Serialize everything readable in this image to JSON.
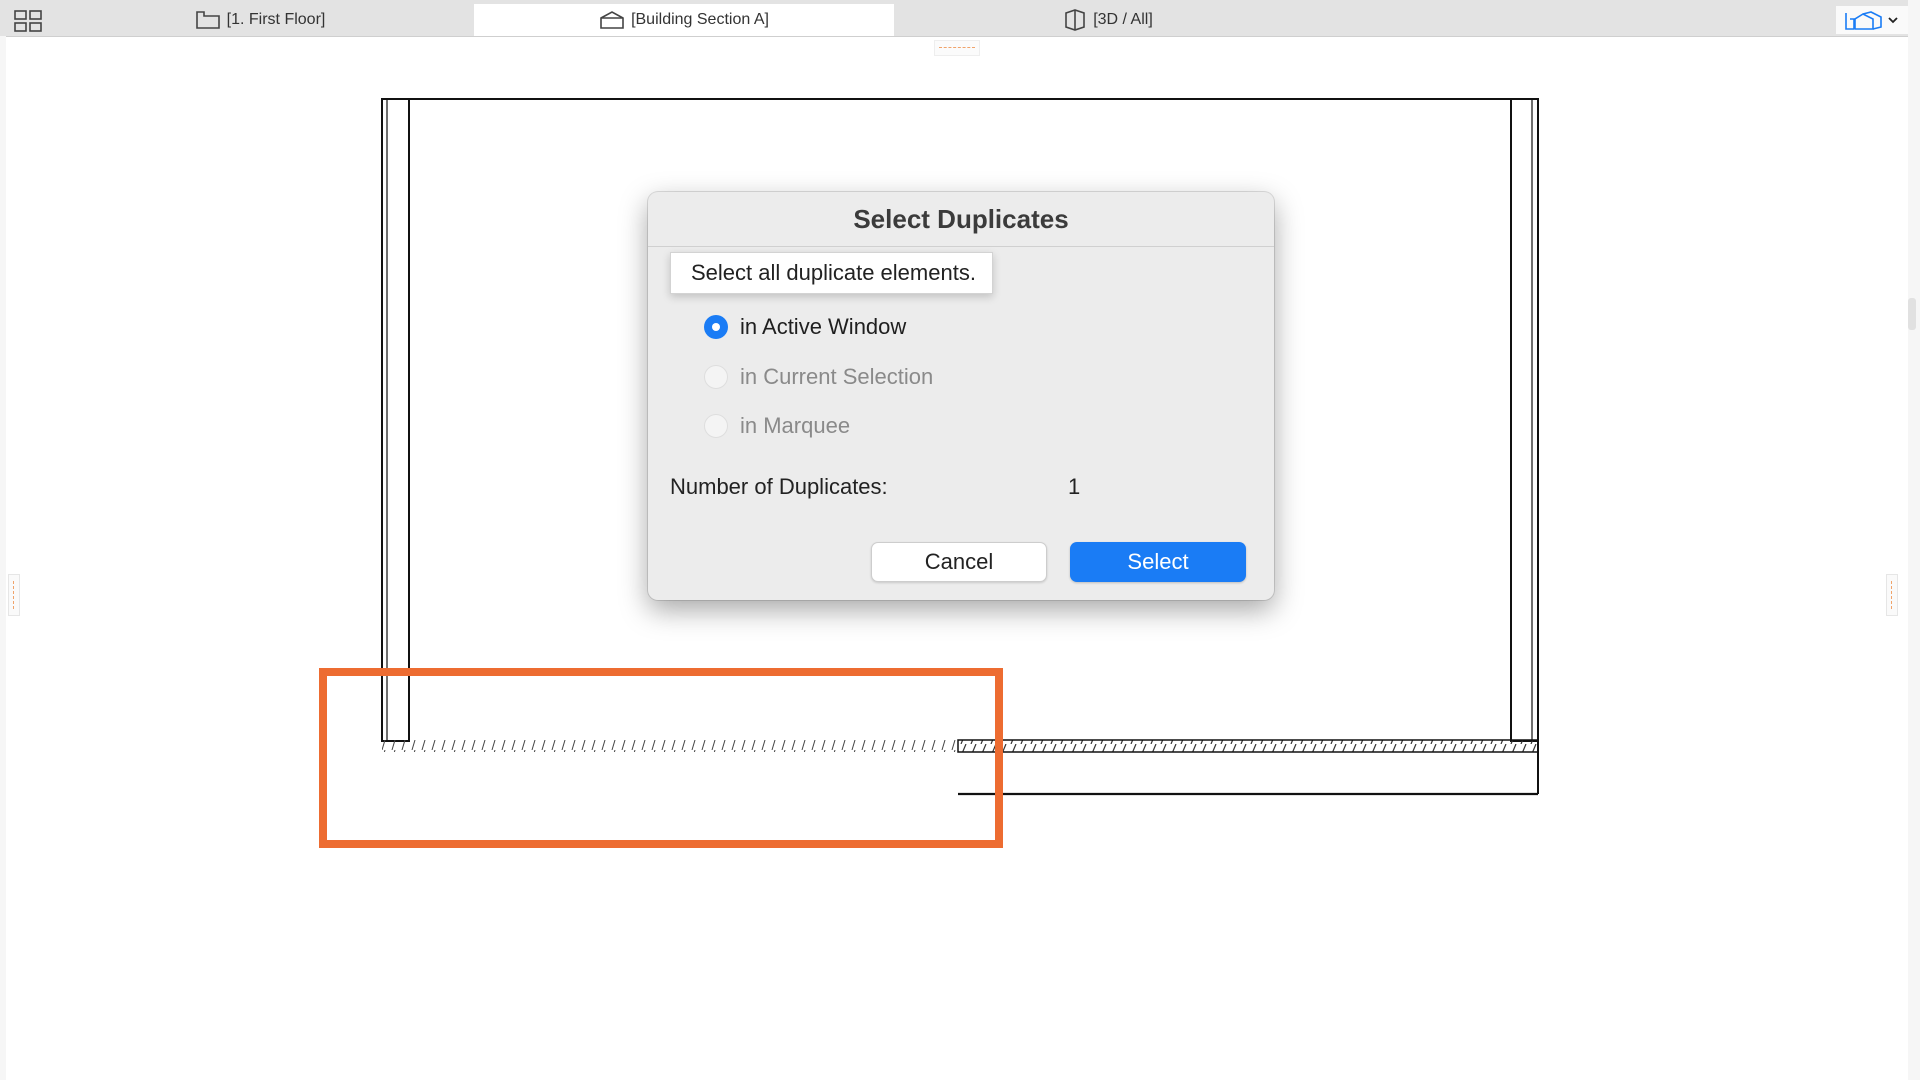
{
  "tabs": [
    {
      "label": "[1. First Floor]",
      "icon": "floor-plan-icon",
      "active": false
    },
    {
      "label": "[Building Section A]",
      "icon": "section-icon",
      "active": true
    },
    {
      "label": "[3D / All]",
      "icon": "3d-icon",
      "active": false
    }
  ],
  "dialog": {
    "title": "Select Duplicates",
    "tooltip": "Select all duplicate elements.",
    "options": [
      {
        "label": "in Active Window",
        "selected": true,
        "enabled": true
      },
      {
        "label": "in Current Selection",
        "selected": false,
        "enabled": false
      },
      {
        "label": "in Marquee",
        "selected": false,
        "enabled": false
      }
    ],
    "count_label": "Number of Duplicates:",
    "count_value": "1",
    "cancel_label": "Cancel",
    "select_label": "Select"
  },
  "colors": {
    "accent": "#1a7cf5",
    "highlight": "#ed6c31",
    "tabbar": "#e3e3e3",
    "dialog_bg": "#ececec"
  }
}
